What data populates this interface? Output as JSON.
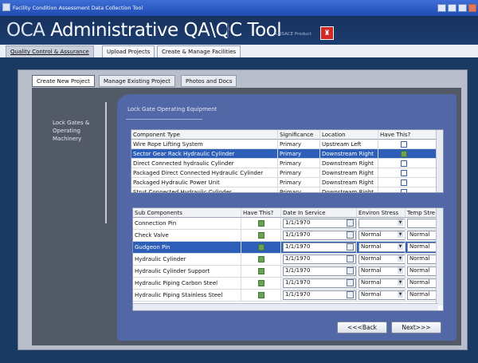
{
  "window": {
    "title": "Facility Condition Assessment Data Collection Tool",
    "buttons": [
      "minimize-icon",
      "restore-icon",
      "help-icon",
      "close-icon"
    ]
  },
  "header": {
    "app_title_prefix": "OCA ",
    "app_title_main": "Administrative QA\\QC Tool",
    "product_label": "A USACE Product",
    "logo_glyph": "♜",
    "colors": {
      "band": "#16315c",
      "logo": "#d42828",
      "selection": "#2d5fb8",
      "panel": "#5267a6"
    }
  },
  "top_tabs": [
    {
      "label": "Quality Control & Assurance",
      "active": true
    },
    {
      "label": "Upload Projects",
      "active": false
    },
    {
      "label": "Create & Manage Facilities",
      "active": false
    }
  ],
  "inner_tabs": [
    {
      "label": "Create New Project",
      "active": true
    },
    {
      "label": "Manage Existing Project",
      "active": false
    },
    {
      "label": "Photos and Docs",
      "active": false
    }
  ],
  "left_nav": {
    "text": "Lock Gates & Operating Machinery"
  },
  "panel": {
    "title": "Lock Gate Operating Equipment"
  },
  "components_grid": {
    "columns": [
      "Component Type",
      "Significance",
      "Location",
      "Have This?"
    ],
    "rows": [
      {
        "type": "Wire Rope Lifting System",
        "significance": "Primary",
        "location": "Upstream Left",
        "checked": false,
        "selected": false
      },
      {
        "type": "Sector Gear Rack Hydraulic Cylinder",
        "significance": "Primary",
        "location": "Downstream Right",
        "checked": true,
        "selected": true
      },
      {
        "type": "Direct Connected hydraulic Cylinder",
        "significance": "Primary",
        "location": "Downstream Right",
        "checked": false,
        "selected": false
      },
      {
        "type": "Packaged Direct Connected Hydraulic Cylinder",
        "significance": "Primary",
        "location": "Downstream Right",
        "checked": false,
        "selected": false
      },
      {
        "type": "Packaged Hydraulic Power Unit",
        "significance": "Primary",
        "location": "Downstream Right",
        "checked": false,
        "selected": false
      },
      {
        "type": "Strut Connected Hydraulic Cylinder",
        "significance": "Primary",
        "location": "Downstream Right",
        "checked": false,
        "selected": false
      }
    ]
  },
  "subcomponents_grid": {
    "columns": [
      "Sub Components",
      "Have This?",
      "Date In Service",
      "Environ Stress",
      "Temp Stre"
    ],
    "rows": [
      {
        "name": "Connection Pin",
        "checked": true,
        "date": "1/1/1970",
        "environ": "",
        "temp": "",
        "selected": false
      },
      {
        "name": "Check Valve",
        "checked": true,
        "date": "1/1/1970",
        "environ": "Normal",
        "temp": "Normal",
        "selected": false
      },
      {
        "name": "Gudgeon Pin",
        "checked": true,
        "date": "1/1/1970",
        "environ": "Normal",
        "temp": "Normal",
        "selected": true
      },
      {
        "name": "Hydraulic Cylinder",
        "checked": true,
        "date": "1/1/1970",
        "environ": "Normal",
        "temp": "Normal",
        "selected": false
      },
      {
        "name": "Hydraulic Cylinder Support",
        "checked": true,
        "date": "1/1/1970",
        "environ": "Normal",
        "temp": "Normal",
        "selected": false
      },
      {
        "name": "Hydraulic Piping Carbon Steel",
        "checked": true,
        "date": "1/1/1970",
        "environ": "Normal",
        "temp": "Normal",
        "selected": false
      },
      {
        "name": "Hydraulic Piping Stainless Steel",
        "checked": true,
        "date": "1/1/1970",
        "environ": "Normal",
        "temp": "Normal",
        "selected": false
      }
    ]
  },
  "nav_buttons": {
    "back": "<<<Back",
    "next": "Next>>>"
  }
}
